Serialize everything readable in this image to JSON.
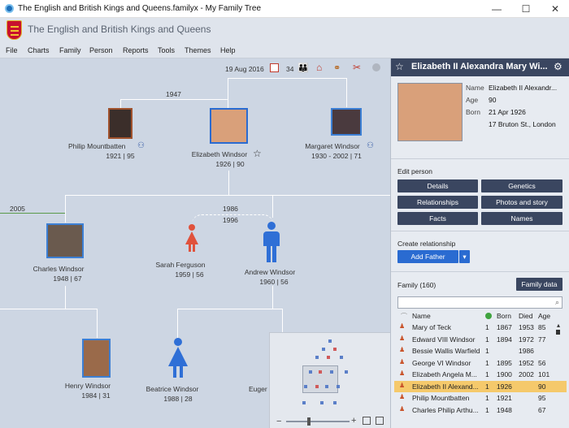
{
  "window": {
    "title": "The English and British Kings and Queens.familyx - My Family Tree",
    "min": "—",
    "max": "☐",
    "close": "✕"
  },
  "banner": {
    "title": "The English and British Kings and Queens"
  },
  "menu": [
    "File",
    "Charts",
    "Family",
    "Person",
    "Reports",
    "Tools",
    "Themes",
    "Help"
  ],
  "toolbar": {
    "date": "19 Aug 2016",
    "count": "34"
  },
  "chart": {
    "marriage1_year": "1947",
    "marriage2_year": "2005",
    "marriage3_year1": "1986",
    "marriage3_year2": "1996",
    "people": {
      "philip": {
        "name": "Philip Mountbatten",
        "dates": "1921 | 95"
      },
      "elizabeth": {
        "name": "Elizabeth Windsor",
        "dates": "1926 | 90"
      },
      "margaret": {
        "name": "Margaret Windsor",
        "dates": "1930 - 2002 | 71"
      },
      "charles": {
        "name": "Charles Windsor",
        "dates": "1948 | 67"
      },
      "sarah": {
        "name": "Sarah Ferguson",
        "dates": "1959 | 56"
      },
      "andrew": {
        "name": "Andrew Windsor",
        "dates": "1960 | 56"
      },
      "henry": {
        "name": "Henry Windsor",
        "dates": "1984 | 31"
      },
      "beatrice": {
        "name": "Beatrice Windsor",
        "dates": "1988 | 28"
      },
      "eugenie": {
        "name": "Euger"
      }
    }
  },
  "panel": {
    "header_name": "Elizabeth II Alexandra Mary Wi...",
    "labels": {
      "name": "Name",
      "age": "Age",
      "born": "Born"
    },
    "values": {
      "name": "Elizabeth II Alexandr...",
      "age": "90",
      "born": "21 Apr 1926",
      "place": "17 Bruton St., London"
    },
    "edit_person": "Edit person",
    "buttons": {
      "details": "Details",
      "genetics": "Genetics",
      "relationships": "Relationships",
      "photos": "Photos and story",
      "facts": "Facts",
      "names": "Names"
    },
    "create_relationship": "Create relationship",
    "add_father": "Add Father",
    "family_label": "Family (160)",
    "family_data": "Family data",
    "columns": {
      "name": "Name",
      "born": "Born",
      "died": "Died",
      "age": "Age"
    },
    "rows": [
      {
        "name": "Mary of Teck",
        "n": "1",
        "born": "1867",
        "died": "1953",
        "age": "85"
      },
      {
        "name": "Edward VIII Windsor",
        "n": "1",
        "born": "1894",
        "died": "1972",
        "age": "77"
      },
      {
        "name": "Bessie Wallis Warfield",
        "n": "1",
        "born": "",
        "died": "1986",
        "age": ""
      },
      {
        "name": "George VI Windsor",
        "n": "1",
        "born": "1895",
        "died": "1952",
        "age": "56"
      },
      {
        "name": "Elizabeth Angela M...",
        "n": "1",
        "born": "1900",
        "died": "2002",
        "age": "101"
      },
      {
        "name": "Elizabeth II Alexand...",
        "n": "1",
        "born": "1926",
        "died": "",
        "age": "90"
      },
      {
        "name": "Philip Mountbatten",
        "n": "1",
        "born": "1921",
        "died": "",
        "age": "95"
      },
      {
        "name": "Charles Philip Arthu...",
        "n": "1",
        "born": "1948",
        "died": "",
        "age": "67"
      }
    ]
  },
  "colors": {
    "accent": "#3a4660",
    "highlight": "#f5c96b",
    "chart_bg": "#cdd6e3",
    "female": "#e0523c",
    "male": "#2f6fd6"
  },
  "icons": [
    "calendar-icon",
    "people-icon",
    "home-icon",
    "tree-icon",
    "tools-icon",
    "gear-icon",
    "star-icon",
    "search-icon"
  ]
}
